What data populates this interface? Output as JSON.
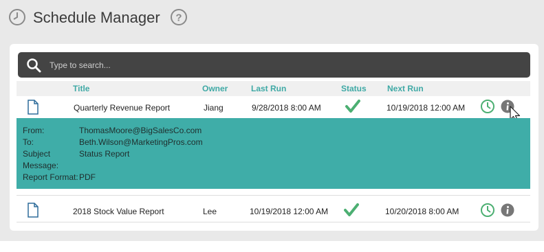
{
  "header": {
    "title": "Schedule Manager",
    "clock_icon": "clock-icon",
    "help_icon": "help-icon"
  },
  "search": {
    "placeholder": "Type to search...",
    "value": ""
  },
  "table": {
    "columns": [
      "Title",
      "Owner",
      "Last Run",
      "Status",
      "Next Run"
    ],
    "rows": [
      {
        "title": "Quarterly Revenue Report",
        "owner": "Jiang",
        "last_run": "9/28/2018 8:00 AM",
        "status": "success",
        "next_run": "10/19/2018 12:00 AM",
        "expanded": true
      },
      {
        "title": "2018 Stock Value Report",
        "owner": "Lee",
        "last_run": "10/19/2018 12:00 AM",
        "status": "success",
        "next_run": "10/20/2018 8:00 AM",
        "expanded": false
      }
    ]
  },
  "details": {
    "from_label": "From:",
    "from_value": "ThomasMoore@BigSalesCo.com",
    "to_label": "To:",
    "to_value": "Beth.Wilson@MarketingPros.com",
    "subject_label": "Subject",
    "subject_value": "Status Report",
    "message_label": "Message:",
    "message_value": "",
    "format_label": "Report Format:",
    "format_value": "PDF"
  },
  "colors": {
    "accent": "#3fa9a5",
    "detail_bg": "#3fada8",
    "success": "#4caf72",
    "search_bg": "#444444"
  }
}
